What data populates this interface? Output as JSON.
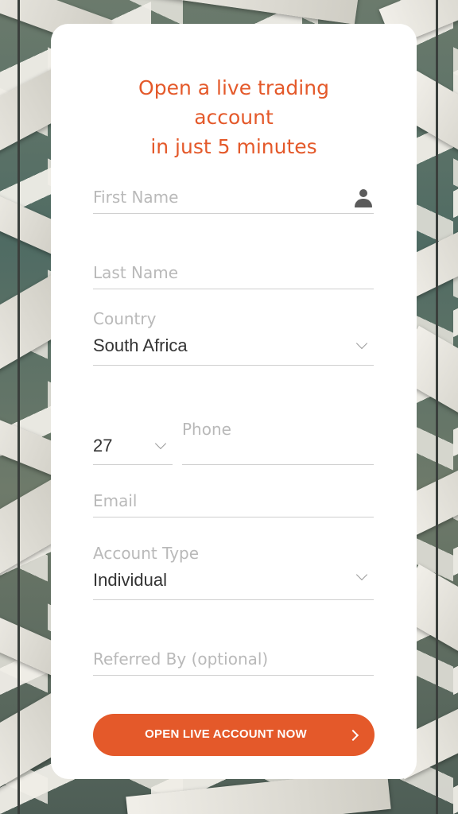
{
  "form": {
    "title_lines": [
      "Open a live trading",
      "account",
      "in just 5 minutes"
    ],
    "first_name": {
      "placeholder": "First Name",
      "icon": "person-icon"
    },
    "last_name": {
      "placeholder": "Last Name"
    },
    "country": {
      "label": "Country",
      "value": "South Africa"
    },
    "phone": {
      "country_code": "27",
      "placeholder": "Phone"
    },
    "email": {
      "placeholder": "Email"
    },
    "account_type": {
      "label": "Account Type",
      "value": "Individual"
    },
    "referred_by": {
      "placeholder": "Referred By (optional)"
    },
    "submit": {
      "label": "OPEN LIVE ACCOUNT NOW"
    }
  },
  "colors": {
    "accent": "#e4592a",
    "placeholder": "#b9b9b9",
    "value": "#333333",
    "card": "#ffffff"
  }
}
